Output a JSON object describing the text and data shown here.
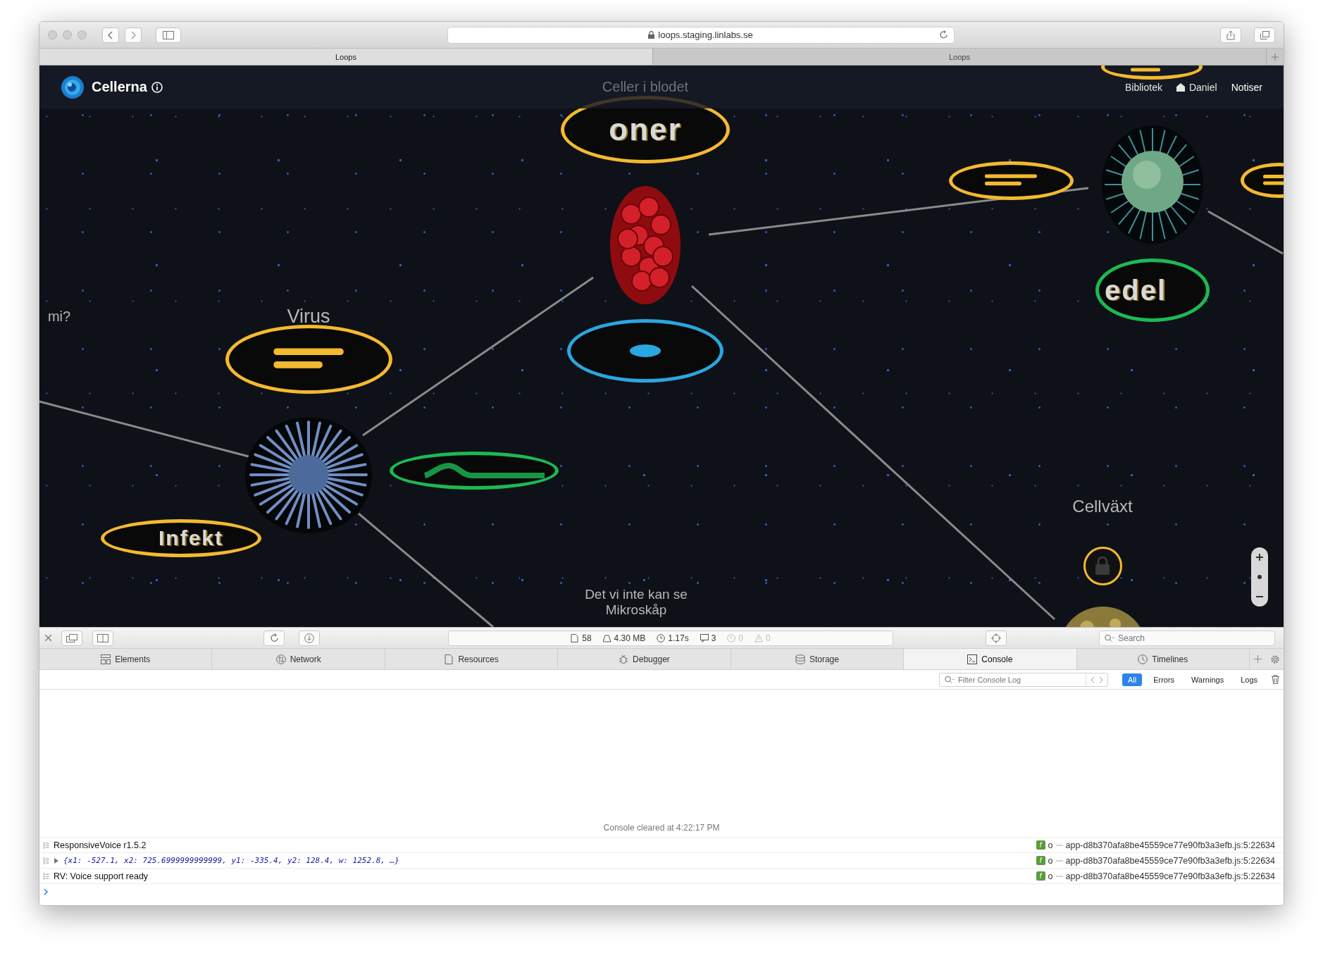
{
  "browser": {
    "url": "loops.staging.linlabs.se",
    "tabs": [
      {
        "label": "Loops",
        "selected": true
      },
      {
        "label": "Loops",
        "selected": false
      }
    ]
  },
  "app": {
    "title": "Cellerna",
    "nav": [
      {
        "kind": "link",
        "label": "Bibliotek"
      },
      {
        "kind": "user",
        "label": "Daniel"
      },
      {
        "kind": "link",
        "label": "Notiser"
      }
    ]
  },
  "canvas": {
    "nodes": [
      {
        "kind": "label",
        "text": "Celler i blodet"
      },
      {
        "kind": "ring-bars",
        "color": "#f4b92f"
      },
      {
        "kind": "ring-text",
        "color": "#f4b92f",
        "text": "oner"
      },
      {
        "kind": "photo"
      },
      {
        "kind": "ring-bars",
        "color": "#f4b92f"
      },
      {
        "kind": "photo"
      },
      {
        "kind": "ring-bars",
        "color": "#f4b92f"
      },
      {
        "kind": "ring-text",
        "color": "#1db954",
        "text": "edel"
      },
      {
        "kind": "label",
        "text": "mi?"
      },
      {
        "kind": "label",
        "text": "Virus"
      },
      {
        "kind": "ring-bars",
        "color": "#f4b92f"
      },
      {
        "kind": "ring-dot",
        "color": "#2aa6e0"
      },
      {
        "kind": "photo"
      },
      {
        "kind": "ring-smudge",
        "color": "#1db954"
      },
      {
        "kind": "ring-text",
        "color": "#f4b92f",
        "text": "Infekt"
      },
      {
        "kind": "label",
        "text": "Cellväxt"
      },
      {
        "kind": "lock",
        "color": "#f4b92f"
      },
      {
        "kind": "label",
        "text": "Det vi inte kan se"
      },
      {
        "kind": "label",
        "text": "Mikroskåp"
      },
      {
        "kind": "photo"
      }
    ]
  },
  "devtools": {
    "status": [
      {
        "kind": "resources",
        "value": "58"
      },
      {
        "kind": "size",
        "value": "4.30 MB"
      },
      {
        "kind": "time",
        "value": "1.17s"
      },
      {
        "kind": "logs",
        "value": "3"
      },
      {
        "kind": "errors",
        "value": "0"
      },
      {
        "kind": "warnings",
        "value": "0"
      }
    ],
    "search": {
      "placeholder": "Search"
    },
    "tabs": [
      {
        "kind": "elements",
        "label": "Elements",
        "selected": false
      },
      {
        "kind": "network",
        "label": "Network",
        "selected": false
      },
      {
        "kind": "resources",
        "label": "Resources",
        "selected": false
      },
      {
        "kind": "debugger",
        "label": "Debugger",
        "selected": false
      },
      {
        "kind": "storage",
        "label": "Storage",
        "selected": false
      },
      {
        "kind": "console",
        "label": "Console",
        "selected": true
      },
      {
        "kind": "timelines",
        "label": "Timelines",
        "selected": false
      }
    ],
    "filter": {
      "placeholder": "Filter Console Log"
    },
    "levels": [
      {
        "label": "All",
        "selected": true
      },
      {
        "label": "Errors",
        "selected": false
      },
      {
        "label": "Warnings",
        "selected": false
      },
      {
        "label": "Logs",
        "selected": false
      }
    ],
    "cleared": "Console cleared at 4:22:17 PM",
    "messages": [
      {
        "kind": "log",
        "text": "ResponsiveVoice r1.5.2",
        "badge": "f",
        "caller": "o",
        "source": "app-d8b370afa8be45559ce77e90fb3a3efb.js:5:22634"
      },
      {
        "kind": "object",
        "text": "{x1: -527.1, x2: 725.6999999999999, y1: -335.4, y2: 128.4, w: 1252.8, …}",
        "badge": "f",
        "caller": "o",
        "source": "app-d8b370afa8be45559ce77e90fb3a3efb.js:5:22634"
      },
      {
        "kind": "log",
        "text": "RV: Voice support ready",
        "badge": "f",
        "caller": "o",
        "source": "app-d8b370afa8be45559ce77e90fb3a3efb.js:5:22634"
      }
    ]
  }
}
